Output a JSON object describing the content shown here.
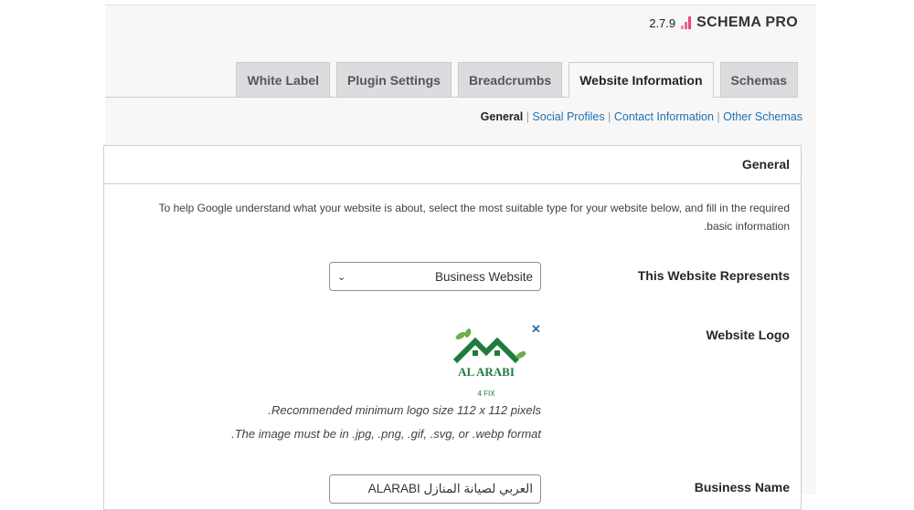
{
  "brand": {
    "version": "2.7.9",
    "name": "SCHEMA PRO",
    "accent": "#f0407a"
  },
  "tabs": [
    {
      "label": "White Label"
    },
    {
      "label": "Plugin Settings"
    },
    {
      "label": "Breadcrumbs"
    },
    {
      "label": "Website Information",
      "active": true
    },
    {
      "label": "Schemas"
    }
  ],
  "subnav": {
    "general": "General",
    "social": "Social Profiles",
    "contact": "Contact Information",
    "other": "Other Schemas",
    "sep": "|"
  },
  "panel": {
    "title": "General",
    "description": "To help Google understand what your website is about, select the most suitable type for your website below, and fill in the required basic information.",
    "represents_label": "This Website Represents",
    "represents_value": "Business Website",
    "logo_label": "Website Logo",
    "logo_text": "AL ARABI",
    "logo_sub": "4 FIX",
    "logo_note1": "Recommended minimum logo size 112 x 112 pixels.",
    "logo_note2": "The image must be in .jpg, .png, .gif, .svg, or .webp format.",
    "business_name_label": "Business Name",
    "business_name_value": "العربي لصيانة المنازل ALARABI"
  }
}
